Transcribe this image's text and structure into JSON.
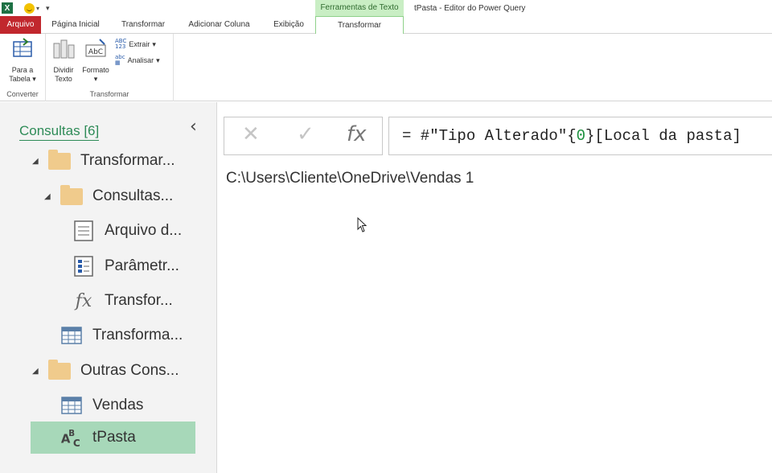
{
  "title_bar": {
    "app_letter": "X",
    "context_tab_group": "Ferramentas de Texto",
    "window_title": "tPasta - Editor do Power Query"
  },
  "tabs": {
    "file": "Arquivo",
    "home": "Página Inicial",
    "transform": "Transformar",
    "add_column": "Adicionar Coluna",
    "view": "Exibição",
    "text_transform": "Transformar"
  },
  "ribbon": {
    "groups": {
      "convert": {
        "label": "Converter",
        "to_table_line1": "Para a",
        "to_table_line2": "Tabela"
      },
      "transform": {
        "label": "Transformar",
        "split_line1": "Dividir",
        "split_line2": "Texto",
        "format": "Formato",
        "extract": "Extrair",
        "parse": "Analisar"
      }
    },
    "icons": {
      "to_table": "table-convert-icon",
      "split": "split-column-icon",
      "format": "text-format-icon",
      "extract": "abc-123-icon",
      "parse": "parse-icon"
    },
    "dropdown_arrow": "▾"
  },
  "queries_pane": {
    "header": "Consultas [6]",
    "collapse_glyph": "‹",
    "items": [
      {
        "label": "Transformar...",
        "type": "folder",
        "expanded": true
      },
      {
        "label": "Consultas...",
        "type": "folder",
        "expanded": true
      },
      {
        "label": "Arquivo d...",
        "type": "text-file"
      },
      {
        "label": "Parâmetr...",
        "type": "parameter"
      },
      {
        "label": "Transfor...",
        "type": "function"
      },
      {
        "label": "Transforma...",
        "type": "table"
      },
      {
        "label": "Outras Cons...",
        "type": "folder",
        "expanded": true
      },
      {
        "label": "Vendas",
        "type": "table"
      },
      {
        "label": "tPasta",
        "type": "text-value",
        "selected": true
      }
    ]
  },
  "formula_bar": {
    "cancel_glyph": "✕",
    "commit_glyph": "✓",
    "fx_glyph": "fx",
    "formula_prefix": "= #\"Tipo Alterado\"{",
    "formula_index": "0",
    "formula_suffix": "}[Local da pasta]"
  },
  "result": {
    "value": "C:\\Users\\Cliente\\OneDrive\\Vendas 1"
  },
  "colors": {
    "file_tab": "#c1272d",
    "context_tab": "#c9eec4",
    "selected_item": "#a7d8b9",
    "header_green": "#2e8b57",
    "folder": "#f0cb8c"
  }
}
